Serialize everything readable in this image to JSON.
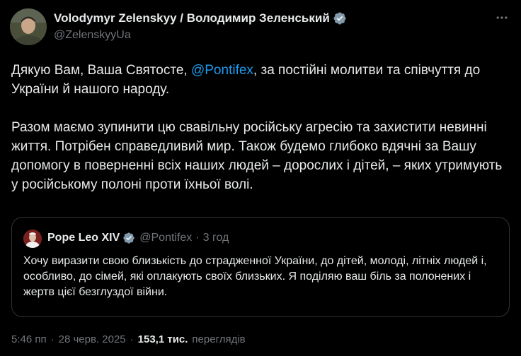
{
  "author": {
    "display_name": "Volodymyr Zelenskyy / Володимир Зеленський",
    "handle": "@ZelenskyyUa",
    "verified_color": "#1d9bf0",
    "avatar_icon": "avatar-photo"
  },
  "more_icon": "more-dots-icon",
  "tweet": {
    "p1_before": "Дякую Вам, Ваша Святосте, ",
    "p1_mention": "@Pontifex",
    "p1_after": ", за постійні молитви та співчуття до України й нашого народу.",
    "p2": "Разом маємо зупинити цю свавільну російську агресію та захистити невинні життя. Потрібен справедливий мир. Також будемо глибоко вдячні за Вашу допомогу в поверненні всіх наших людей – дорослих і дітей, – яких утримують у російському полоні проти їхньої волі."
  },
  "quote": {
    "name": "Pope Leo XIV",
    "handle": "@Pontifex",
    "dot": "·",
    "time": "3 год",
    "text": "Хочу виразити свою близькість до страдженної України, до дітей, молоді, літніх людей і, особливо, до сімей, які оплакують своїх близьких. Я поділяю ваш біль за полонених і жертв цієї безглуздої війни."
  },
  "meta": {
    "time": "5:46 пп",
    "sep1": "·",
    "date": "28 черв. 2025",
    "sep2": "·",
    "views_count": "153,1 тис.",
    "views_label": "переглядів"
  },
  "colors": {
    "background": "#000000",
    "text": "#e7e9ea",
    "secondary": "#71767b",
    "link": "#1d9bf0",
    "border": "#2f3336"
  }
}
